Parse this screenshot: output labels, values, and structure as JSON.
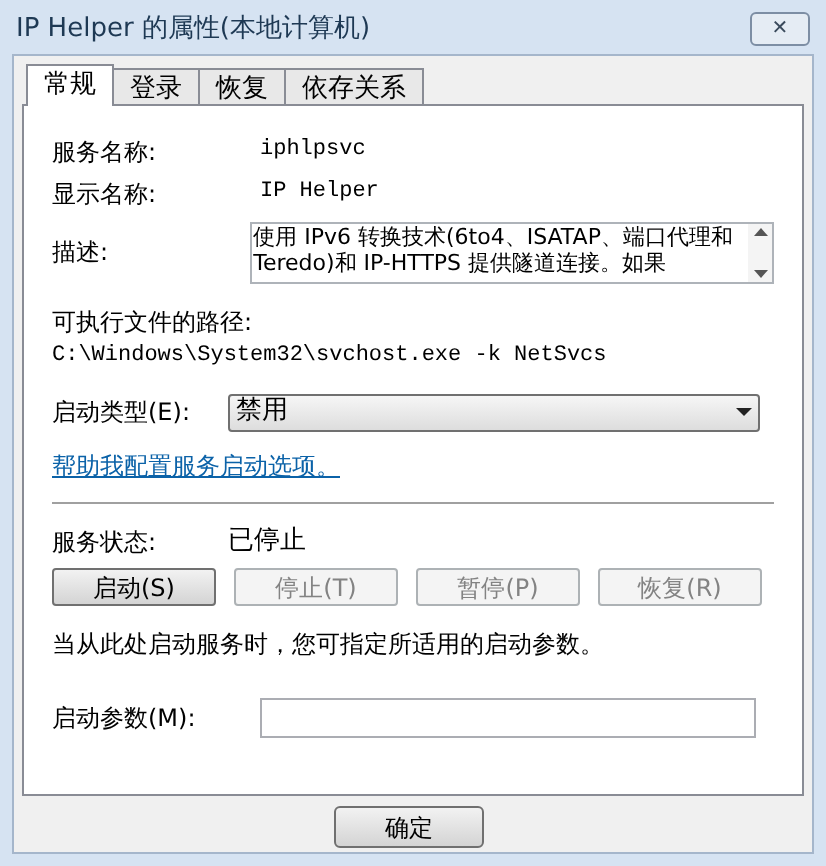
{
  "window": {
    "title": "IP Helper 的属性(本地计算机)",
    "close": "✕"
  },
  "tabs": [
    {
      "label": "常规",
      "selected": true
    },
    {
      "label": "登录",
      "selected": false
    },
    {
      "label": "恢复",
      "selected": false
    },
    {
      "label": "依存关系",
      "selected": false
    }
  ],
  "service_name": {
    "label": "服务名称:",
    "value": "iphlpsvc"
  },
  "display_name": {
    "label": "显示名称:",
    "value": "IP Helper"
  },
  "description": {
    "label": "描述:",
    "value": "使用 IPv6 转换技术(6to4、ISATAP、端口代理和 Teredo)和 IP-HTTPS 提供隧道连接。如果"
  },
  "executable_path": {
    "label": "可执行文件的路径:",
    "value": "C:\\Windows\\System32\\svchost.exe -k NetSvcs"
  },
  "startup_type": {
    "label": "启动类型(E):",
    "value": "禁用"
  },
  "help_link": "帮助我配置服务启动选项。",
  "service_status": {
    "label": "服务状态:",
    "value": "已停止"
  },
  "service_buttons": [
    {
      "label": "启动(S)",
      "disabled": false
    },
    {
      "label": "停止(T)",
      "disabled": true
    },
    {
      "label": "暂停(P)",
      "disabled": true
    },
    {
      "label": "恢复(R)",
      "disabled": true
    }
  ],
  "hint": "当从此处启动服务时，您可指定所适用的启动参数。",
  "start_parameters": {
    "label": "启动参数(M):"
  },
  "dialog_buttons": [
    "确定"
  ]
}
